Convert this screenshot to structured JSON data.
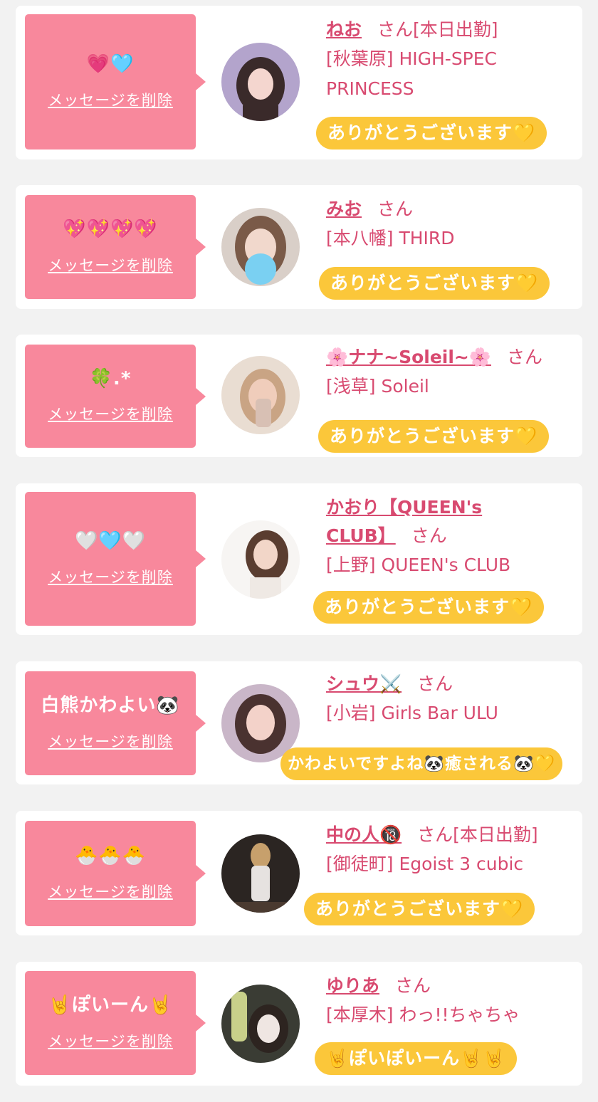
{
  "delete_label": "メッセージを削除",
  "suffix": "さん",
  "messages": [
    {
      "message": "💗🩵",
      "name": "ねお",
      "status": "[本日出勤]",
      "shop": "[秋葉原] HIGH-SPEC PRINCESS",
      "reply": "ありがとうございます💛",
      "avatar_colors": [
        "#b3a4cc",
        "#3a2a2a",
        "#f4d6cf"
      ]
    },
    {
      "message": "💖💖💖💖",
      "name": "みお",
      "status": "",
      "shop": "[本八幡] THIRD",
      "reply": "ありがとうございます💛",
      "avatar_colors": [
        "#d9cfc8",
        "#7a5a48",
        "#7ad0f2"
      ]
    },
    {
      "message": "🍀.*",
      "name": "🌸ナナ~Soleil~🌸",
      "status": "",
      "shop": "[浅草] Soleil",
      "reply": "ありがとうございます💛",
      "avatar_colors": [
        "#e9ddd2",
        "#c9a484",
        "#f0cdbb"
      ]
    },
    {
      "message": "🤍🩵🤍",
      "name": "かおり【QUEEN's CLUB】",
      "status": "",
      "shop": "[上野] QUEEN's CLUB",
      "reply": "ありがとうございます💛",
      "avatar_colors": [
        "#f7f5f3",
        "#5a3d30",
        "#f2d6c8"
      ]
    },
    {
      "message": "白熊かわよい🐼",
      "name": "シュウ⚔️",
      "status": "",
      "shop": "[小岩] Girls Bar ULU",
      "reply": "かわよいですよね🐼癒される🐼💛",
      "avatar_colors": [
        "#c9b6c8",
        "#4a3230",
        "#f3d2c9"
      ]
    },
    {
      "message": "🐣🐣🐣",
      "name": "中の人🔞",
      "status": "[本日出勤]",
      "shop": "[御徒町] Egoist 3 cubic",
      "reply": "ありがとうございます💛",
      "avatar_colors": [
        "#2b2522",
        "#c7a06c",
        "#e6e2e0"
      ]
    },
    {
      "message": "🤘ぽいーん🤘",
      "name": "ゆりあ",
      "status": "",
      "shop": "[本厚木] わっ!!ちゃちゃ",
      "reply": "🤘ぽいぽいーん🤘🤘",
      "avatar_colors": [
        "#3a3c34",
        "#c8d08a",
        "#efe6e2"
      ]
    }
  ]
}
